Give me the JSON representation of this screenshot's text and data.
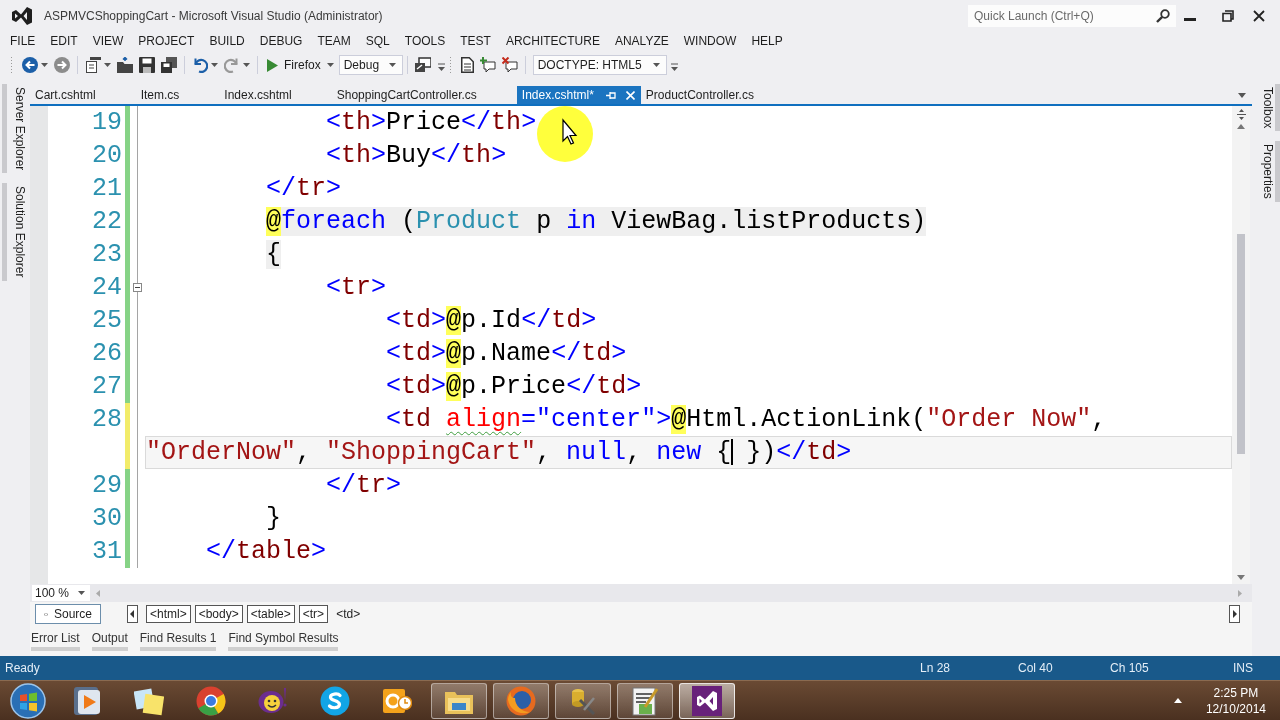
{
  "window": {
    "title": "ASPMVCShoppingCart - Microsoft Visual Studio (Administrator)",
    "quick_launch": {
      "placeholder": "Quick Launch (Ctrl+Q)"
    }
  },
  "menu": [
    "FILE",
    "EDIT",
    "VIEW",
    "PROJECT",
    "BUILD",
    "DEBUG",
    "TEAM",
    "SQL",
    "TOOLS",
    "TEST",
    "ARCHITECTURE",
    "ANALYZE",
    "WINDOW",
    "HELP"
  ],
  "toolbar": {
    "run_target": "Firefox",
    "configuration": "Debug",
    "doctype": "DOCTYPE: HTML5"
  },
  "side_tabs_left": [
    "Server Explorer",
    "Solution Explorer"
  ],
  "side_tabs_right": [
    "Toolbox",
    "Properties"
  ],
  "tabs": [
    {
      "label": "Cart.cshtml",
      "selected": false
    },
    {
      "label": "Item.cs",
      "selected": false
    },
    {
      "label": "Index.cshtml",
      "selected": false
    },
    {
      "label": "ShoppingCartController.cs",
      "selected": false
    },
    {
      "label": "Index.cshtml*",
      "selected": true
    },
    {
      "label": "ProductController.cs",
      "selected": false
    }
  ],
  "editor": {
    "lines": [
      {
        "number": "19",
        "saved": true,
        "collapsible": false,
        "code_block": false,
        "current": false,
        "tokens": [
          {
            "kind": "delim",
            "text": "            <"
          },
          {
            "kind": "tag",
            "text": "th"
          },
          {
            "kind": "delim",
            "text": ">"
          },
          {
            "kind": "text",
            "text": "Price"
          },
          {
            "kind": "delim",
            "text": "</"
          },
          {
            "kind": "tag",
            "text": "th"
          },
          {
            "kind": "delim",
            "text": ">"
          }
        ]
      },
      {
        "number": "20",
        "saved": true,
        "collapsible": false,
        "code_block": false,
        "current": false,
        "tokens": [
          {
            "kind": "delim",
            "text": "            <"
          },
          {
            "kind": "tag",
            "text": "th"
          },
          {
            "kind": "delim",
            "text": ">"
          },
          {
            "kind": "text",
            "text": "Buy"
          },
          {
            "kind": "delim",
            "text": "</"
          },
          {
            "kind": "tag",
            "text": "th"
          },
          {
            "kind": "delim",
            "text": ">"
          }
        ]
      },
      {
        "number": "21",
        "saved": true,
        "collapsible": false,
        "code_block": false,
        "current": false,
        "tokens": [
          {
            "kind": "delim",
            "text": "        </"
          },
          {
            "kind": "tag",
            "text": "tr"
          },
          {
            "kind": "delim",
            "text": ">"
          }
        ]
      },
      {
        "number": "22",
        "saved": true,
        "collapsible": false,
        "code_block": true,
        "current": false,
        "tokens": [
          {
            "kind": "razor",
            "text": "        @"
          },
          {
            "kind": "keyword",
            "text": "foreach"
          },
          {
            "kind": "code",
            "text": " ("
          },
          {
            "kind": "type",
            "text": "Product"
          },
          {
            "kind": "code",
            "text": " p "
          },
          {
            "kind": "keyword",
            "text": "in"
          },
          {
            "kind": "code",
            "text": " ViewBag.listProducts)"
          }
        ]
      },
      {
        "number": "23",
        "saved": true,
        "collapsible": false,
        "code_block": true,
        "current": false,
        "tokens": [
          {
            "kind": "code",
            "text": "        {"
          }
        ]
      },
      {
        "number": "24",
        "saved": true,
        "collapsible": true,
        "code_block": false,
        "current": false,
        "tokens": [
          {
            "kind": "delim",
            "text": "            <"
          },
          {
            "kind": "tag",
            "text": "tr"
          },
          {
            "kind": "delim",
            "text": ">"
          }
        ]
      },
      {
        "number": "25",
        "saved": true,
        "collapsible": false,
        "code_block": false,
        "current": false,
        "tokens": [
          {
            "kind": "delim",
            "text": "                <"
          },
          {
            "kind": "tag",
            "text": "td"
          },
          {
            "kind": "delim",
            "text": ">"
          },
          {
            "kind": "razor",
            "text": "@"
          },
          {
            "kind": "code",
            "text": "p.Id"
          },
          {
            "kind": "delim",
            "text": "</"
          },
          {
            "kind": "tag",
            "text": "td"
          },
          {
            "kind": "delim",
            "text": ">"
          }
        ]
      },
      {
        "number": "26",
        "saved": true,
        "collapsible": false,
        "code_block": false,
        "current": false,
        "tokens": [
          {
            "kind": "delim",
            "text": "                <"
          },
          {
            "kind": "tag",
            "text": "td"
          },
          {
            "kind": "delim",
            "text": ">"
          },
          {
            "kind": "razor",
            "text": "@"
          },
          {
            "kind": "code",
            "text": "p.Name"
          },
          {
            "kind": "delim",
            "text": "</"
          },
          {
            "kind": "tag",
            "text": "td"
          },
          {
            "kind": "delim",
            "text": ">"
          }
        ]
      },
      {
        "number": "27",
        "saved": true,
        "collapsible": false,
        "code_block": false,
        "current": false,
        "tokens": [
          {
            "kind": "delim",
            "text": "                <"
          },
          {
            "kind": "tag",
            "text": "td"
          },
          {
            "kind": "delim",
            "text": ">"
          },
          {
            "kind": "razor",
            "text": "@"
          },
          {
            "kind": "code",
            "text": "p.Price"
          },
          {
            "kind": "delim",
            "text": "</"
          },
          {
            "kind": "tag",
            "text": "td"
          },
          {
            "kind": "delim",
            "text": ">"
          }
        ]
      },
      {
        "number": "28",
        "saved": false,
        "collapsible": false,
        "code_block": false,
        "current": false,
        "tokens": [
          {
            "kind": "delim",
            "text": "                <"
          },
          {
            "kind": "tag",
            "text": "td "
          },
          {
            "kind": "flagged",
            "text": "align"
          },
          {
            "kind": "delim",
            "text": "="
          },
          {
            "kind": "value",
            "text": "\"center\""
          },
          {
            "kind": "delim",
            "text": ">"
          },
          {
            "kind": "razor",
            "text": "@"
          },
          {
            "kind": "code",
            "text": "Html.ActionLink("
          },
          {
            "kind": "string",
            "text": "\"Order Now\""
          },
          {
            "kind": "code",
            "text": ","
          }
        ]
      },
      {
        "saved": false,
        "collapsible": false,
        "code_block": false,
        "current": true,
        "tokens": [
          {
            "kind": "string",
            "text": "\"OrderNow\""
          },
          {
            "kind": "code",
            "text": ", "
          },
          {
            "kind": "string",
            "text": "\"ShoppingCart\""
          },
          {
            "kind": "code",
            "text": ", "
          },
          {
            "kind": "keyword",
            "text": "null"
          },
          {
            "kind": "code",
            "text": ", "
          },
          {
            "kind": "keyword",
            "text": "new"
          },
          {
            "kind": "code",
            "text": " {"
          },
          {
            "kind": "caret"
          },
          {
            "kind": "code",
            "text": " })"
          },
          {
            "kind": "delim",
            "text": "</"
          },
          {
            "kind": "tag",
            "text": "td"
          },
          {
            "kind": "delim",
            "text": ">"
          }
        ]
      },
      {
        "number": "29",
        "saved": true,
        "collapsible": false,
        "code_block": false,
        "current": false,
        "tokens": [
          {
            "kind": "delim",
            "text": "            </"
          },
          {
            "kind": "tag",
            "text": "tr"
          },
          {
            "kind": "delim",
            "text": ">"
          }
        ]
      },
      {
        "number": "30",
        "saved": true,
        "collapsible": false,
        "code_block": false,
        "current": false,
        "tokens": [
          {
            "kind": "code",
            "text": "        }"
          }
        ]
      },
      {
        "number": "31",
        "saved": true,
        "collapsible": false,
        "code_block": false,
        "current": false,
        "tokens": [
          {
            "kind": "delim",
            "text": "    </"
          },
          {
            "kind": "tag",
            "text": "table"
          },
          {
            "kind": "delim",
            "text": ">"
          }
        ]
      }
    ]
  },
  "zoom": "100 %",
  "breadcrumb": {
    "view": "Source",
    "items": [
      {
        "label": "<html>",
        "selected": false
      },
      {
        "label": "<body>",
        "selected": false
      },
      {
        "label": "<table>",
        "selected": false
      },
      {
        "label": "<tr>",
        "selected": false
      },
      {
        "label": "<td>",
        "selected": true
      }
    ]
  },
  "tool_tabs": [
    "Error List",
    "Output",
    "Find Results 1",
    "Find Symbol Results"
  ],
  "status_bar": {
    "message": "Ready",
    "line": "Ln 28",
    "column": "Col 40",
    "character": "Ch 105",
    "mode": "INS"
  },
  "taskbar": {
    "items": [
      {
        "kind": "player",
        "running": false,
        "selected": false
      },
      {
        "kind": "notes",
        "running": false,
        "selected": false
      },
      {
        "kind": "globe",
        "running": false,
        "selected": false
      },
      {
        "kind": "smiley",
        "running": false,
        "selected": false
      },
      {
        "kind": "chat",
        "running": false,
        "selected": false
      },
      {
        "kind": "mail",
        "running": false,
        "selected": false
      },
      {
        "kind": "folder",
        "running": true,
        "selected": false
      },
      {
        "kind": "fox",
        "running": true,
        "selected": false
      },
      {
        "kind": "tools",
        "running": true,
        "selected": false
      },
      {
        "kind": "notepad",
        "running": true,
        "selected": false
      },
      {
        "kind": "studio",
        "running": true,
        "selected": true
      }
    ],
    "time": "2:25 PM",
    "date": "12/10/2014"
  }
}
